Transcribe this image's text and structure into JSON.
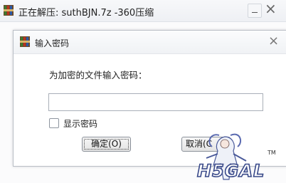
{
  "outer_window": {
    "title": "正在解压: suthBJN.7z -360压缩",
    "close_glyph": "×"
  },
  "dialog": {
    "title": "输入密码",
    "close_glyph": "×",
    "prompt": "为加密的文件输入密码：",
    "password_value": "",
    "show_password_label": "显示密码",
    "show_password_checked": false,
    "ok_label": "确定(O)",
    "cancel_label": "取消(C"
  },
  "watermark": {
    "logo_text": "H5GAL",
    "trademark": "TM"
  },
  "icons": [
    "archive-app-icon",
    "close-icon",
    "minimize-icon"
  ],
  "colors": {
    "titlebar": "#f0f2f5",
    "border": "#b9bec6",
    "button_face": "#e3e3e3",
    "watermark_stroke": "#3a4a8a"
  }
}
